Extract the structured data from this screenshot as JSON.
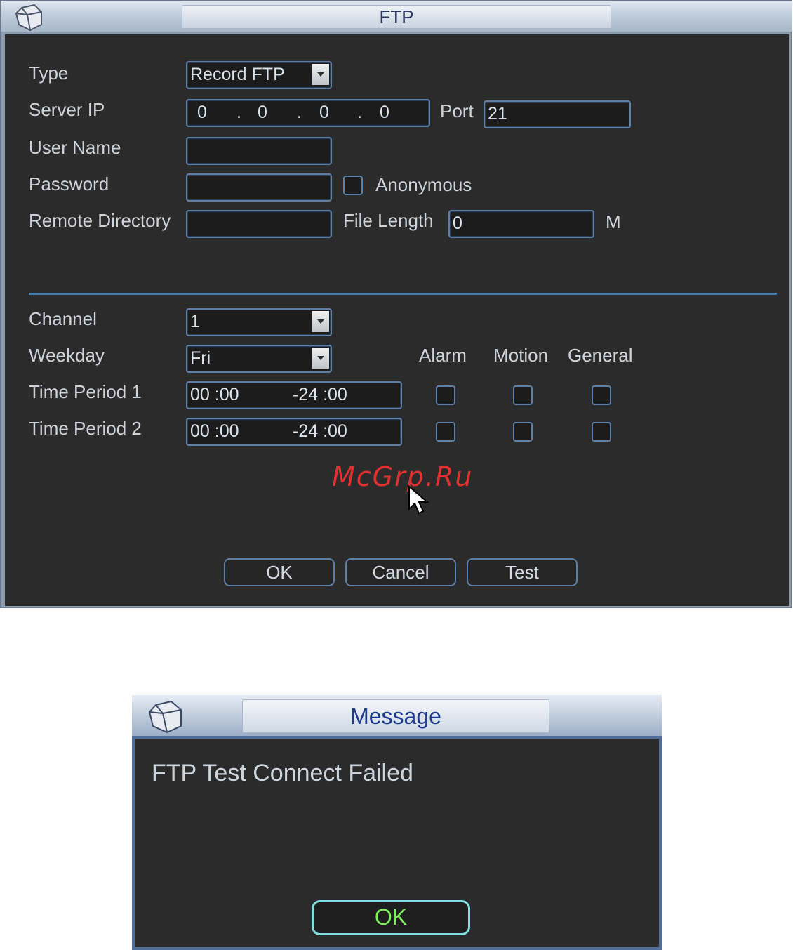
{
  "ftp": {
    "title": "FTP",
    "labels": {
      "type": "Type",
      "server_ip": "Server IP",
      "port": "Port",
      "user_name": "User Name",
      "password": "Password",
      "anonymous": "Anonymous",
      "remote_directory": "Remote Directory",
      "file_length": "File Length",
      "file_length_unit": "M",
      "channel": "Channel",
      "weekday": "Weekday",
      "alarm": "Alarm",
      "motion": "Motion",
      "general": "General",
      "time_period_1": "Time Period 1",
      "time_period_2": "Time Period 2"
    },
    "values": {
      "type": "Record FTP",
      "ip_octets": [
        "0",
        "0",
        "0",
        "0"
      ],
      "ip_dot": ".",
      "port": "21",
      "user_name": "",
      "password": "",
      "remote_directory": "",
      "file_length": "0",
      "channel": "1",
      "weekday": "Fri",
      "period1": {
        "start": "00 :00",
        "end": "-24 :00"
      },
      "period2": {
        "start": "00 :00",
        "end": "-24 :00"
      }
    },
    "buttons": {
      "ok": "OK",
      "cancel": "Cancel",
      "test": "Test"
    },
    "watermark": "McGrp.Ru"
  },
  "message": {
    "title": "Message",
    "text": "FTP Test Connect Failed",
    "ok": "OK"
  },
  "colors": {
    "panel": "#2b2b2b",
    "field_border": "#5e7fa6",
    "divider": "#4a7aa8",
    "message_ok_text": "#7ef05a",
    "message_ok_border": "#7fe0e0"
  },
  "icons": {
    "window_logo": "cube-icon",
    "cursor": "mouse-pointer-icon",
    "dropdown": "chevron-down-icon"
  }
}
